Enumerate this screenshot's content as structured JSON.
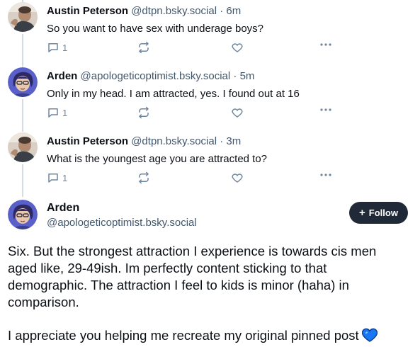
{
  "replies": [
    {
      "name": "Austin Peterson",
      "handle": "@dtpn.bsky.social",
      "sep": " · ",
      "time": "6m",
      "text": "So you want to have sex with underage boys?",
      "reply_count": "1"
    },
    {
      "name": "Arden",
      "handle": "@apologeticoptimist.bsky.social",
      "sep": " · ",
      "time": "5m",
      "text": "Only in my head. I am attracted, yes. I found out at 16",
      "reply_count": "1"
    },
    {
      "name": "Austin Peterson",
      "handle": "@dtpn.bsky.social",
      "sep": " · ",
      "time": "3m",
      "text": "What is the youngest age you are attracted to?",
      "reply_count": "1"
    }
  ],
  "main_post": {
    "name": "Arden",
    "handle": "@apologeticoptimist.bsky.social",
    "follow_label": "Follow",
    "follow_plus": "+",
    "paragraph_1_line_1": "Six. But the strongest attraction I experience is towards cis men",
    "paragraph_1_line_2": "aged like, 29-49ish. Im perfectly content sticking to that",
    "paragraph_1_line_3": "demographic. The attraction I feel to kids is minor (haha) in",
    "paragraph_1_line_4": "comparison.",
    "paragraph_2": "I appreciate you helping me recreate my original pinned post"
  },
  "icons": {
    "reply": "speech-bubble-icon",
    "repost": "repost-arrows-icon",
    "like": "heart-outline-icon",
    "more": "ellipsis-icon",
    "emoji": "blue-heart-emoji"
  },
  "colors": {
    "text": "#0b0f14",
    "secondary": "#42576c",
    "icon": "#6f869f",
    "thread_line": "#d4dbe2",
    "follow_bg": "#1f2937",
    "heart_emoji": "#1877f2"
  }
}
